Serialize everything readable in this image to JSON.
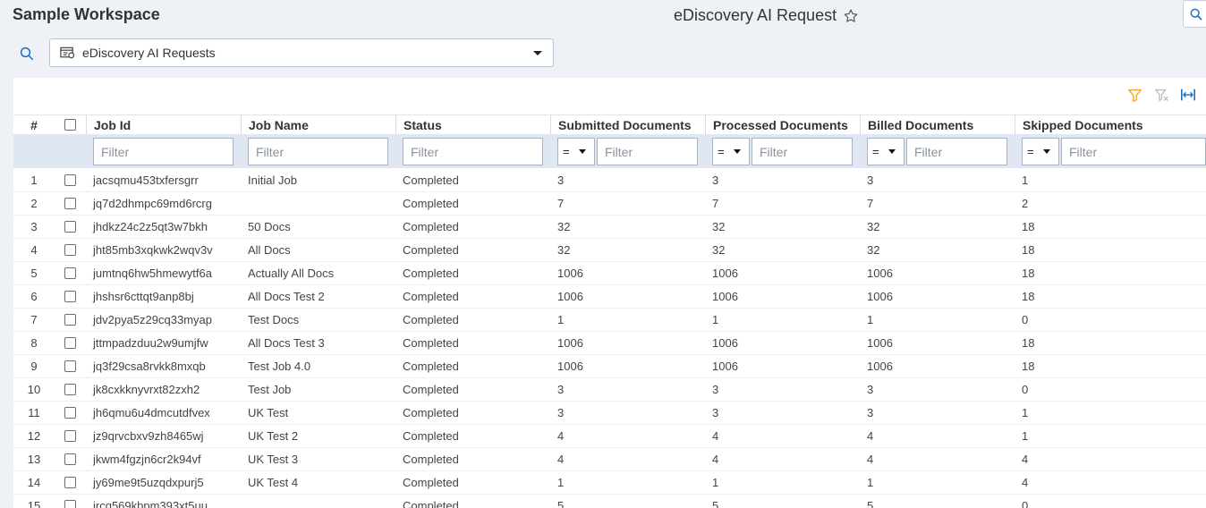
{
  "header": {
    "workspace": "Sample Workspace",
    "title": "eDiscovery AI Request",
    "star_icon": "star-outline-icon"
  },
  "view_selector": {
    "label": "eDiscovery AI Requests",
    "icon": "view-list-icon"
  },
  "toolbar": {
    "icons": [
      "filter-icon",
      "clear-filter-icon",
      "fit-columns-icon"
    ],
    "filter_color": "#f5a623",
    "accent_color": "#1b6ec2"
  },
  "columns": {
    "num": "#",
    "job_id": "Job Id",
    "job_name": "Job Name",
    "status": "Status",
    "submitted": "Submitted Documents",
    "processed": "Processed Documents",
    "billed": "Billed Documents",
    "skipped": "Skipped Documents"
  },
  "filters": {
    "placeholder": "Filter",
    "operator": "="
  },
  "rows": [
    {
      "n": "1",
      "id": "jacsqmu453txfersgrr",
      "name": "Initial Job",
      "status": "Completed",
      "submitted": "3",
      "processed": "3",
      "billed": "3",
      "skipped": "1"
    },
    {
      "n": "2",
      "id": "jq7d2dhmpc69md6rcrg",
      "name": "",
      "status": "Completed",
      "submitted": "7",
      "processed": "7",
      "billed": "7",
      "skipped": "2"
    },
    {
      "n": "3",
      "id": "jhdkz24c2z5qt3w7bkh",
      "name": "50 Docs",
      "status": "Completed",
      "submitted": "32",
      "processed": "32",
      "billed": "32",
      "skipped": "18"
    },
    {
      "n": "4",
      "id": "jht85mb3xqkwk2wqv3v",
      "name": "All Docs",
      "status": "Completed",
      "submitted": "32",
      "processed": "32",
      "billed": "32",
      "skipped": "18"
    },
    {
      "n": "5",
      "id": "jumtnq6hw5hmewytf6a",
      "name": "Actually All Docs",
      "status": "Completed",
      "submitted": "1006",
      "processed": "1006",
      "billed": "1006",
      "skipped": "18"
    },
    {
      "n": "6",
      "id": "jhshsr6cttqt9anp8bj",
      "name": "All Docs Test 2",
      "status": "Completed",
      "submitted": "1006",
      "processed": "1006",
      "billed": "1006",
      "skipped": "18"
    },
    {
      "n": "7",
      "id": "jdv2pya5z29cq33myap",
      "name": "Test Docs",
      "status": "Completed",
      "submitted": "1",
      "processed": "1",
      "billed": "1",
      "skipped": "0"
    },
    {
      "n": "8",
      "id": "jttmpadzduu2w9umjfw",
      "name": "All Docs Test 3",
      "status": "Completed",
      "submitted": "1006",
      "processed": "1006",
      "billed": "1006",
      "skipped": "18"
    },
    {
      "n": "9",
      "id": "jq3f29csa8rvkk8mxqb",
      "name": "Test Job 4.0",
      "status": "Completed",
      "submitted": "1006",
      "processed": "1006",
      "billed": "1006",
      "skipped": "18"
    },
    {
      "n": "10",
      "id": "jk8cxkknyvrxt82zxh2",
      "name": "Test Job",
      "status": "Completed",
      "submitted": "3",
      "processed": "3",
      "billed": "3",
      "skipped": "0"
    },
    {
      "n": "11",
      "id": "jh6qmu6u4dmcutdfvex",
      "name": "UK Test",
      "status": "Completed",
      "submitted": "3",
      "processed": "3",
      "billed": "3",
      "skipped": "1"
    },
    {
      "n": "12",
      "id": "jz9qrvcbxv9zh8465wj",
      "name": "UK Test 2",
      "status": "Completed",
      "submitted": "4",
      "processed": "4",
      "billed": "4",
      "skipped": "1"
    },
    {
      "n": "13",
      "id": "jkwm4fgzjn6cr2k94vf",
      "name": "UK Test 3",
      "status": "Completed",
      "submitted": "4",
      "processed": "4",
      "billed": "4",
      "skipped": "4"
    },
    {
      "n": "14",
      "id": "jy69me9t5uzqdxpurj5",
      "name": "UK Test 4",
      "status": "Completed",
      "submitted": "1",
      "processed": "1",
      "billed": "1",
      "skipped": "4"
    },
    {
      "n": "15",
      "id": "jrcq569kbpm393xt5uu",
      "name": "",
      "status": "Completed",
      "submitted": "5",
      "processed": "5",
      "billed": "5",
      "skipped": "0"
    }
  ]
}
